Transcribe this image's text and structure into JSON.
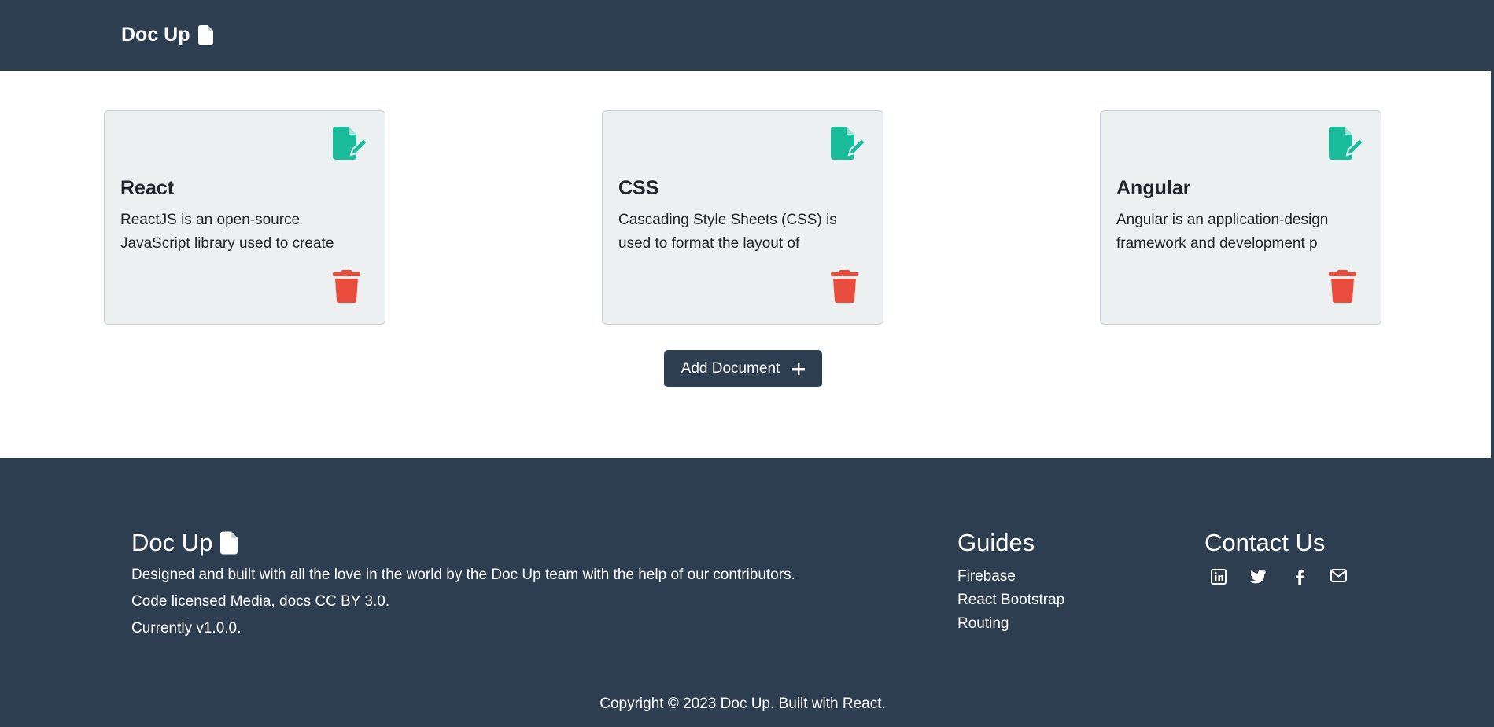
{
  "navbar": {
    "brand": "Doc Up",
    "brand_icon": "file-icon"
  },
  "documents": [
    {
      "title": "React",
      "excerpt": "ReactJS is an open-source JavaScript library used to create",
      "edit_icon": "file-pen-icon",
      "delete_icon": "trash-icon"
    },
    {
      "title": "CSS",
      "excerpt": "Cascading Style Sheets (CSS) is used to format the layout of",
      "edit_icon": "file-pen-icon",
      "delete_icon": "trash-icon"
    },
    {
      "title": "Angular",
      "excerpt": "Angular is an application-design framework and development p",
      "edit_icon": "file-pen-icon",
      "delete_icon": "trash-icon"
    }
  ],
  "add_button": {
    "label": "Add Document",
    "icon": "plus-icon"
  },
  "footer": {
    "brand": "Doc Up",
    "brand_icon": "file-icon",
    "lines": [
      "Designed and built with all the love in the world by the Doc Up team with the help of our contributors.",
      "Code licensed Media, docs CC BY 3.0.",
      "Currently v1.0.0."
    ],
    "guides": {
      "heading": "Guides",
      "links": [
        "Firebase",
        "React Bootstrap",
        "Routing"
      ]
    },
    "contact": {
      "heading": "Contact Us",
      "icons": [
        "linkedin-icon",
        "twitter-icon",
        "facebook-icon",
        "envelope-icon"
      ]
    },
    "copyright": "Copyright © 2023 Doc Up. Built with React."
  },
  "colors": {
    "primary": "#2c3e50",
    "edit": "#1abc9c",
    "delete": "#e74c3c",
    "card_bg": "#ecf0f1"
  }
}
